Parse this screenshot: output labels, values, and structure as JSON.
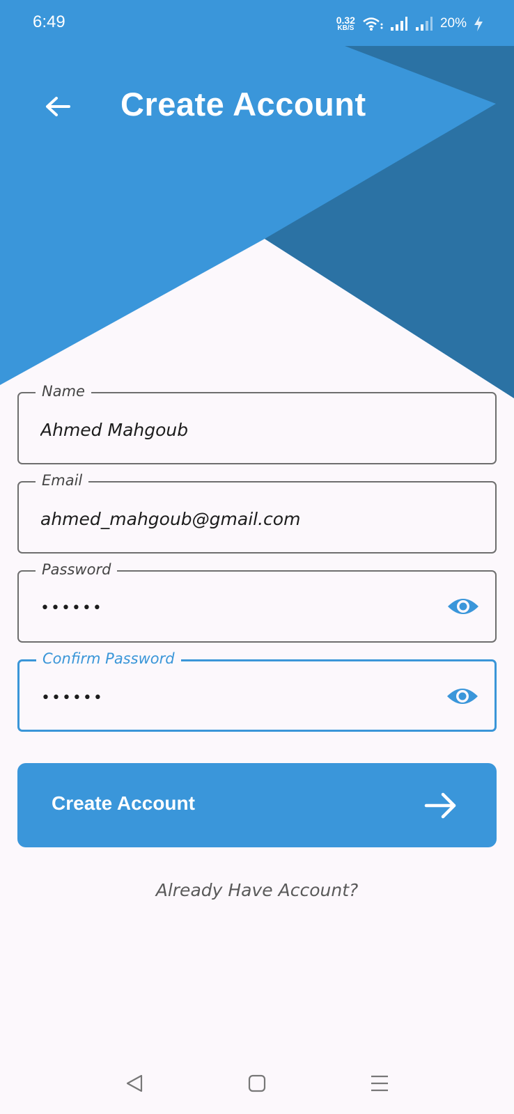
{
  "status_bar": {
    "time": "6:49",
    "net_speed_value": "0.32",
    "net_speed_unit": "KB/S",
    "battery": "20%",
    "icons": [
      "wifi-icon",
      "signal-icon",
      "signal-weak-icon",
      "charging-icon"
    ]
  },
  "header": {
    "title": "Create Account",
    "back_icon": "arrow-left-icon"
  },
  "form": {
    "name": {
      "label": "Name",
      "value": "Ahmed Mahgoub"
    },
    "email": {
      "label": "Email",
      "value": "ahmed_mahgoub@gmail.com"
    },
    "password": {
      "label": "Password",
      "value": "••••••",
      "toggle_icon": "eye-icon"
    },
    "confirm_password": {
      "label": "Confirm Password",
      "value": "••••••",
      "toggle_icon": "eye-icon",
      "focused": true
    }
  },
  "submit": {
    "label": "Create Account",
    "icon": "arrow-right-icon"
  },
  "login_link": "Already Have Account?",
  "nav": {
    "icons": [
      "back-nav-icon",
      "home-nav-icon",
      "recents-nav-icon"
    ]
  },
  "colors": {
    "primary": "#3A96DA",
    "primary_dark": "#2B72A4",
    "background": "#FCF8FC",
    "field_border": "#6E6E6E"
  }
}
